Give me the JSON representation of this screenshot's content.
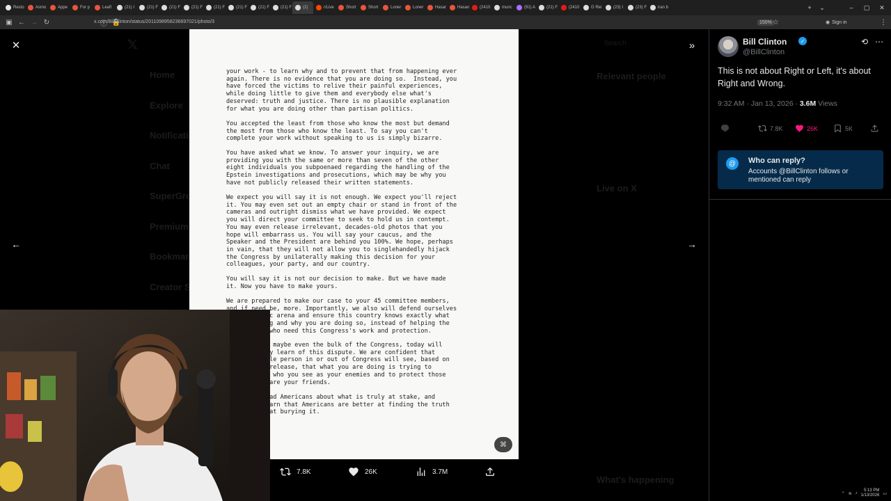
{
  "browser": {
    "tabs": [
      {
        "label": "Resto",
        "color": "#e8e8e8"
      },
      {
        "label": "Asmo",
        "color": "#e8553a"
      },
      {
        "label": "Appe",
        "color": "#e8553a"
      },
      {
        "label": "For p",
        "color": "#e8553a"
      },
      {
        "label": "Leafl",
        "color": "#e8553a"
      },
      {
        "label": "(21) I",
        "color": "#dddddd"
      },
      {
        "label": "(21) F",
        "color": "#dddddd"
      },
      {
        "label": "(21) F",
        "color": "#dddddd"
      },
      {
        "label": "(21) F",
        "color": "#dddddd"
      },
      {
        "label": "(21) F",
        "color": "#dddddd"
      },
      {
        "label": "(21) F",
        "color": "#dddddd"
      },
      {
        "label": "(21) F",
        "color": "#dddddd"
      },
      {
        "label": "(21) F",
        "color": "#dddddd"
      },
      {
        "label": "(2)",
        "color": "#dddddd"
      },
      {
        "label": "r/Live",
        "color": "#ff4500"
      },
      {
        "label": "Short",
        "color": "#e8553a"
      },
      {
        "label": "Short",
        "color": "#e8553a"
      },
      {
        "label": "Loner",
        "color": "#e8553a"
      },
      {
        "label": "Loner",
        "color": "#e8553a"
      },
      {
        "label": "Hasar",
        "color": "#e8553a"
      },
      {
        "label": "Hasan",
        "color": "#e8553a"
      },
      {
        "label": "(2410",
        "color": "#e91916"
      },
      {
        "label": "munc",
        "color": "#dddddd"
      },
      {
        "label": "(91) A",
        "color": "#a970ff"
      },
      {
        "label": "(21) F",
        "color": "#dddddd"
      },
      {
        "label": "(2410",
        "color": "#e91916"
      },
      {
        "label": "G Rei",
        "color": "#dddddd"
      },
      {
        "label": "(23) I",
        "color": "#dddddd"
      },
      {
        "label": "(23) F",
        "color": "#dddddd"
      },
      {
        "label": "iran b",
        "color": "#dddddd"
      }
    ],
    "url": "x.com/BillClinton/status/2011098958236697021/photo/3",
    "zoom": "150%",
    "signin": "Sign in"
  },
  "document": {
    "paragraphs": [
      "your work - to learn why and to prevent that from happening ever\nagain. There is no evidence that you are doing so.  Instead, you\nhave forced the victims to relive their painful experiences,\nwhile doing little to give them and everybody else what's\ndeserved: truth and justice. There is no plausible explanation\nfor what you are doing other than partisan politics.",
      "You accepted the least from those who know the most but demand\nthe most from those who know the least. To say you can't\ncomplete your work without speaking to us is simply bizarre.",
      "You have asked what we know. To answer your inquiry, we are\nproviding you with the same or more than seven of the other\neight individuals you subpoenaed regarding the handling of the\nEpstein investigations and prosecutions, which may be why you\nhave not publicly released their written statements.",
      "We expect you will say it is not enough. We expect you'll reject\nit. You may even set out an empty chair or stand in front of the\ncameras and outright dismiss what we have provided. We expect\nyou will direct your committee to seek to hold us in contempt.\nYou may even release irrelevant, decades-old photos that you\nhope will embarrass us. You will say your caucus, and the\nSpeaker and the President are behind you 100%. We hope, perhaps\nin vain, that they will not allow you to singlehandedly hijack\nthe Congress by unilaterally making this decision for your\ncolleagues, your party, and our country.",
      "You will say it is not our decision to make. But we have made\nit. Now you have to make yours.",
      "We are prepared to make our case to your 45 committee members,\nand if need be, more. Importantly, we also will defend ourselves\nin the public arena and ensure this country knows exactly what\nyou are doing and why you are doing so, instead of helping the\nmany people who need this Congress's work and protection.",
      "Many people, maybe even the bulk of the Congress, today will\nbe upset they learn of this dispute. We are confident that\nany reasonable person in or out of Congress will see, based on\nall we have release, that what you are doing is trying to\npunish those who you see as your enemies and to protect those\nwho you see are your friends.",
      "Do not mislead Americans about what is truly at stake, and\nthey will learn that Americans are better at finding the truth\nthan we are at burying it."
    ]
  },
  "stats": {
    "reposts": "7.8K",
    "likes": "26K",
    "views": "3.7M"
  },
  "tweet": {
    "name": "Bill Clinton",
    "handle": "@BillClinton",
    "text": "This is not about Right or Left, it's about Right and Wrong.",
    "time": "9:32 AM · Jan 13, 2026 · ",
    "views_count": "3.6M",
    "views_label": " Views",
    "reposts": "7.8K",
    "likes": "26K",
    "bookmarks": "5K",
    "reply_title": "Who can reply?",
    "reply_desc": "Accounts @BillClinton follows or mentioned can reply"
  },
  "backdrop": {
    "nav": [
      "Home",
      "Explore",
      "Notifications",
      "Chat",
      "SuperGrok",
      "Premium",
      "Bookmarks",
      "Creator Studio"
    ],
    "search": "Search",
    "relevant": "Relevant people",
    "live": "Live on X",
    "happening": "What's happening"
  },
  "colors": {
    "accent": "#1d9bf0",
    "like": "#f91880",
    "reply_bg": "#062b4a"
  },
  "taskbar": {
    "time": "5:13 PM",
    "date": "1/13/2026"
  }
}
